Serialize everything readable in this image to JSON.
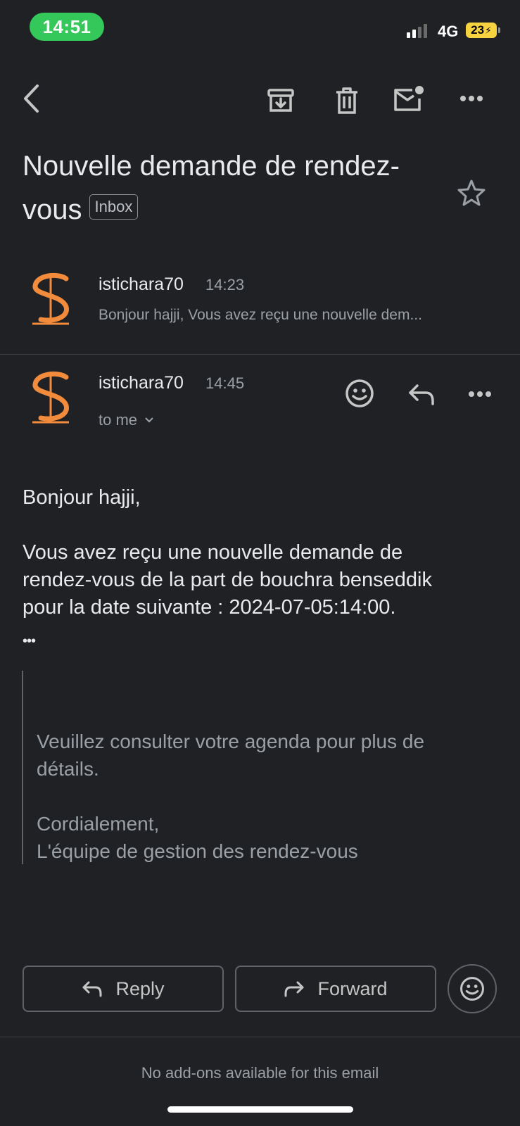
{
  "status_bar": {
    "time": "14:51",
    "network": "4G",
    "battery": "23"
  },
  "toolbar": {
    "back_icon": "back-arrow-icon",
    "archive_icon": "archive-icon",
    "delete_icon": "trash-icon",
    "mark_unread_icon": "mail-unread-icon",
    "more_icon": "more-horiz-icon"
  },
  "subject": {
    "line1": "Nouvelle demande de rendez-",
    "line2": "vous",
    "label": "Inbox"
  },
  "messages": [
    {
      "sender": "istichara70",
      "time": "14:23",
      "snippet": "Bonjour hajji, Vous avez reçu une nouvelle dem..."
    },
    {
      "sender": "istichara70",
      "time": "14:45",
      "recipient": "to me",
      "greeting": "Bonjour hajji,",
      "body_line1": "Vous avez reçu une nouvelle demande de",
      "body_line2": "rendez-vous de la part de bouchra benseddik",
      "body_line3": "pour la date suivante : 2024-07-05:14:00.",
      "ellipsis": "•••",
      "quoted_line1": "Veuillez consulter votre agenda pour plus de",
      "quoted_line2": "détails.",
      "quoted_line3": "Cordialement,",
      "quoted_line4": "L'équipe de gestion des rendez-vous"
    }
  ],
  "actions": {
    "reply": "Reply",
    "forward": "Forward"
  },
  "footer": {
    "addons": "No add-ons available for this email"
  },
  "colors": {
    "background": "#202124",
    "accent_orange": "#f28b3c",
    "status_green": "#34c759"
  }
}
